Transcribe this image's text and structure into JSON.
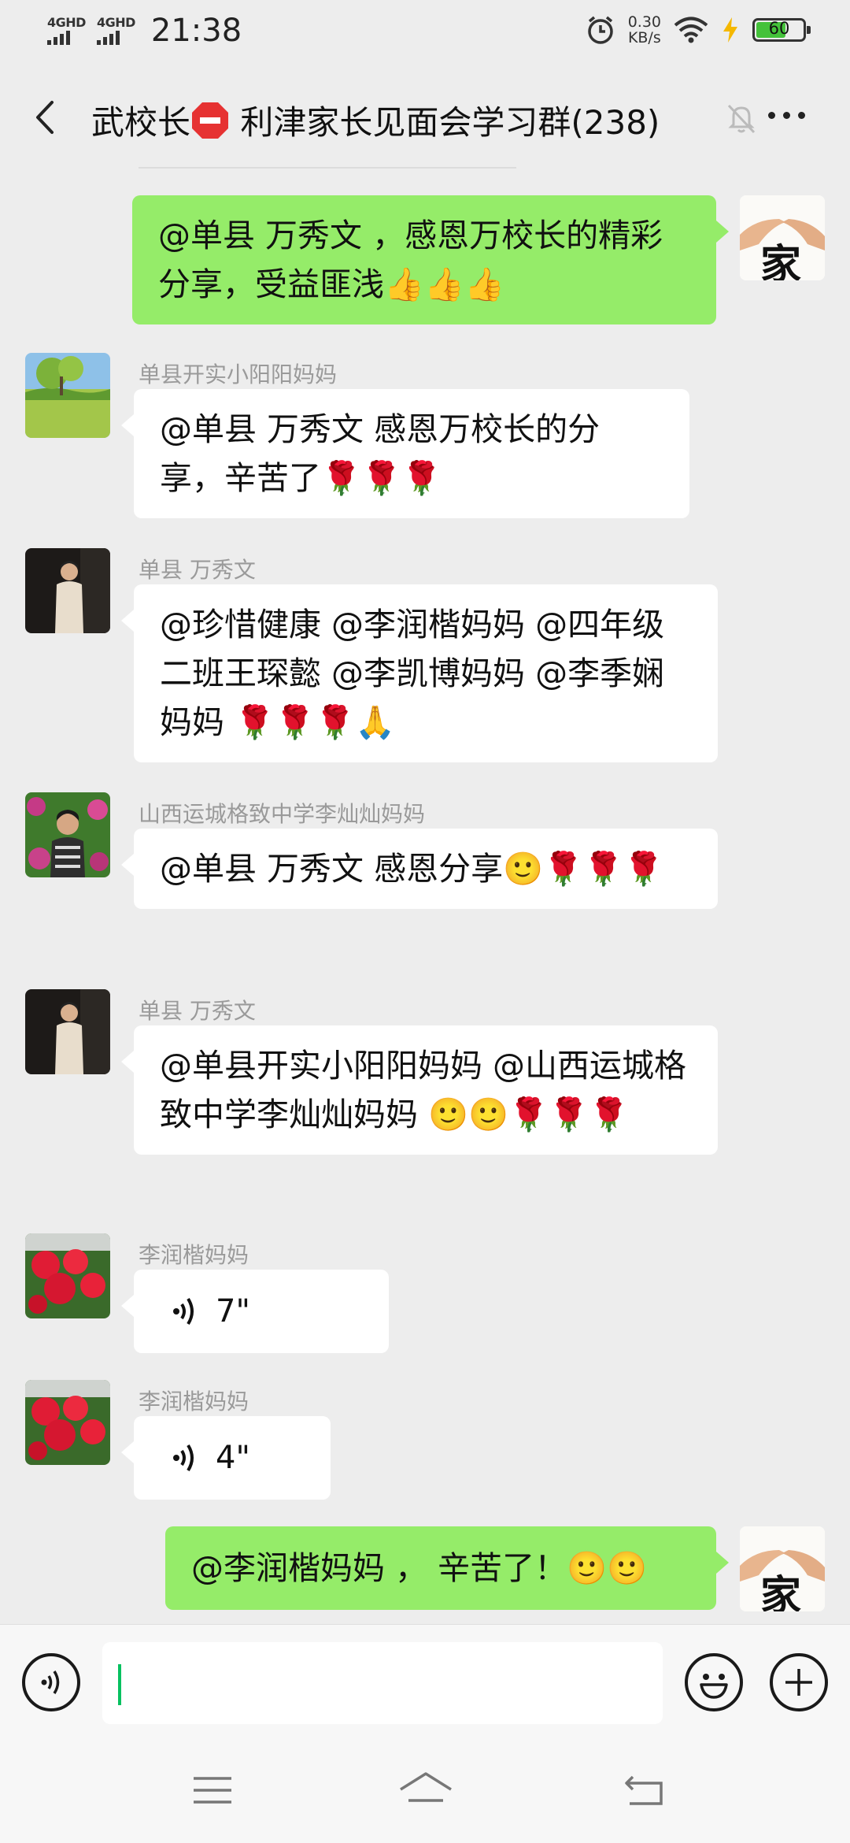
{
  "status": {
    "net1": "4GHD",
    "net2": "4GHD",
    "time": "21:38",
    "speed_value": "0.30",
    "speed_unit": "KB/s",
    "battery": "60"
  },
  "header": {
    "title_part1": "武校长",
    "title_part2": " 利津家长见面会学习群(238)"
  },
  "self_avatar_text": "家",
  "messages": [
    {
      "side": "self",
      "text": "@单县  万秀文 ，感恩万校长的精彩分享，受益匪浅👍👍👍"
    },
    {
      "side": "other",
      "sender": "单县开实小阳阳妈妈",
      "text": "@单县  万秀文  感恩万校长的分享，辛苦了🌹🌹🌹"
    },
    {
      "side": "other",
      "sender": "单县   万秀文",
      "text": "@珍惜健康  @李润楷妈妈  @四年级二班王琛懿  @李凯博妈妈  @李季娴妈妈  🌹🌹🌹🙏"
    },
    {
      "side": "other",
      "sender": "山西运城格致中学李灿灿妈妈",
      "text": "@单县  万秀文  感恩分享🙂🌹🌹🌹"
    },
    {
      "side": "other",
      "sender": "单县   万秀文",
      "text": "@单县开实小阳阳妈妈  @山西运城格致中学李灿灿妈妈  🙂🙂🌹🌹🌹"
    },
    {
      "side": "other",
      "sender": "李润楷妈妈",
      "voice": "7\""
    },
    {
      "side": "other",
      "sender": "李润楷妈妈",
      "voice": "4\""
    },
    {
      "side": "self",
      "text": "@李润楷妈妈 ， 辛苦了！🙂🙂"
    }
  ]
}
